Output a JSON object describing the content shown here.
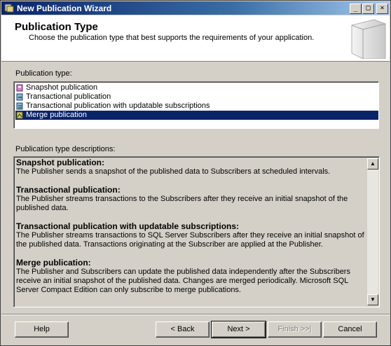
{
  "window": {
    "title": "New Publication Wizard",
    "controls": {
      "minimize": "_",
      "maximize": "□",
      "close": "×"
    }
  },
  "header": {
    "title": "Publication Type",
    "description": "Choose the publication type that best supports the requirements of your application."
  },
  "publication_type": {
    "label": "Publication type:",
    "items": [
      {
        "label": "Snapshot publication",
        "icon": "snapshot-publication-icon"
      },
      {
        "label": "Transactional publication",
        "icon": "transactional-publication-icon"
      },
      {
        "label": "Transactional publication with updatable subscriptions",
        "icon": "updatable-publication-icon"
      },
      {
        "label": "Merge publication",
        "icon": "merge-publication-icon"
      }
    ],
    "selected": "Merge publication"
  },
  "descriptions": {
    "label": "Publication type descriptions:",
    "entries": [
      {
        "heading": "Snapshot publication:",
        "text": "The Publisher sends a snapshot of the published data to Subscribers at scheduled intervals."
      },
      {
        "heading": "Transactional publication:",
        "text": "The Publisher streams transactions to the Subscribers after they receive an initial snapshot of the published data."
      },
      {
        "heading": "Transactional publication with updatable subscriptions:",
        "text": "The Publisher streams transactions to SQL Server Subscribers after they receive an initial snapshot of the published data. Transactions originating at the Subscriber are applied at the Publisher."
      },
      {
        "heading": "Merge publication:",
        "text": "The Publisher and Subscribers can update the published data independently after the Subscribers receive an initial snapshot of the published data. Changes are merged periodically. Microsoft SQL Server Compact Edition can only subscribe to merge publications."
      }
    ]
  },
  "buttons": {
    "help": "Help",
    "back": "< Back",
    "next": "Next >",
    "finish": "Finish >>|",
    "cancel": "Cancel"
  }
}
